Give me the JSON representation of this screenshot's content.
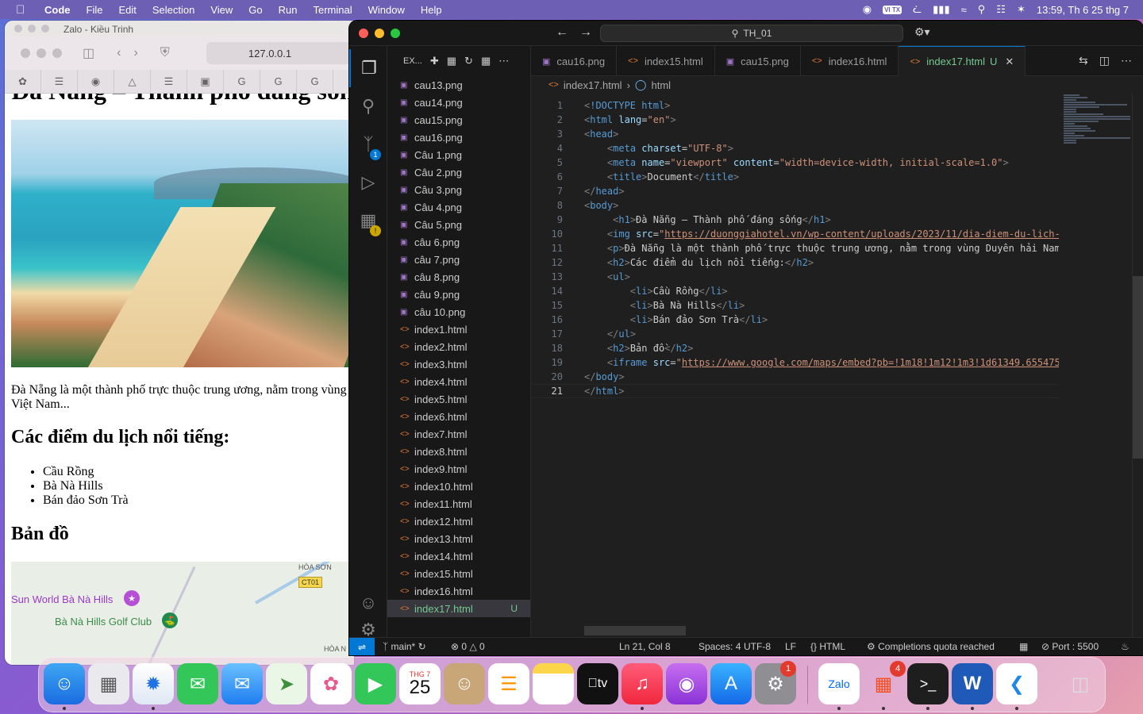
{
  "menubar": {
    "app_name": "Code",
    "menus": [
      "File",
      "Edit",
      "Selection",
      "View",
      "Go",
      "Run",
      "Terminal",
      "Window",
      "Help"
    ],
    "input_source": "VI TX",
    "clock": "13:59, Th 6 25 thg 7"
  },
  "browser": {
    "behind_window_title": "Zalo - Kiều Trinh",
    "url": "127.0.0.1",
    "page": {
      "heading_partial": "Đà Nẵng – Thành phố đáng sống",
      "paragraph_line1": "Đà Nẵng là một thành phố trực thuộc trung ương, nằm trong vùng",
      "paragraph_line2": "Việt Nam...",
      "h2_places": "Các điểm du lịch nổi tiếng:",
      "places": [
        "Cầu Rồng",
        "Bà Nà Hills",
        "Bán đảo Sơn Trà"
      ],
      "h2_map": "Bản đồ",
      "map_labels": {
        "sun_world": "Sun World Bà Nà Hills",
        "golf": "Bà Nà Hills Golf Club",
        "hoa_son": "HÒA SƠN",
        "hoa_n": "HÒA N",
        "road": "CT01"
      }
    }
  },
  "vscode": {
    "command_center": "TH_01",
    "explorer_title": "EX...",
    "files": [
      {
        "name": "cau13.png",
        "type": "img"
      },
      {
        "name": "cau14.png",
        "type": "img"
      },
      {
        "name": "cau15.png",
        "type": "img"
      },
      {
        "name": "cau16.png",
        "type": "img"
      },
      {
        "name": "Câu 1.png",
        "type": "img"
      },
      {
        "name": "Câu 2.png",
        "type": "img"
      },
      {
        "name": "Câu 3.png",
        "type": "img"
      },
      {
        "name": "Câu 4.png",
        "type": "img"
      },
      {
        "name": "Câu 5.png",
        "type": "img"
      },
      {
        "name": "câu 6.png",
        "type": "img"
      },
      {
        "name": "câu 7.png",
        "type": "img"
      },
      {
        "name": "câu 8.png",
        "type": "img"
      },
      {
        "name": "câu 9.png",
        "type": "img"
      },
      {
        "name": "câu 10.png",
        "type": "img"
      },
      {
        "name": "index1.html",
        "type": "html"
      },
      {
        "name": "index2.html",
        "type": "html"
      },
      {
        "name": "index3.html",
        "type": "html"
      },
      {
        "name": "index4.html",
        "type": "html"
      },
      {
        "name": "index5.html",
        "type": "html"
      },
      {
        "name": "index6.html",
        "type": "html"
      },
      {
        "name": "index7.html",
        "type": "html"
      },
      {
        "name": "index8.html",
        "type": "html"
      },
      {
        "name": "index9.html",
        "type": "html"
      },
      {
        "name": "index10.html",
        "type": "html"
      },
      {
        "name": "index11.html",
        "type": "html"
      },
      {
        "name": "index12.html",
        "type": "html"
      },
      {
        "name": "index13.html",
        "type": "html"
      },
      {
        "name": "index14.html",
        "type": "html"
      },
      {
        "name": "index15.html",
        "type": "html"
      },
      {
        "name": "index16.html",
        "type": "html"
      },
      {
        "name": "index17.html",
        "type": "html",
        "active": true,
        "status": "U"
      }
    ],
    "tabs": [
      {
        "label": "cau16.png",
        "type": "img"
      },
      {
        "label": "index15.html",
        "type": "html"
      },
      {
        "label": "cau15.png",
        "type": "img"
      },
      {
        "label": "index16.html",
        "type": "html"
      },
      {
        "label": "index17.html",
        "type": "html",
        "active": true,
        "status": "U"
      }
    ],
    "breadcrumb": [
      "index17.html",
      "html"
    ],
    "code_lines": [
      "<!DOCTYPE html>",
      "<html lang=\"en\">",
      "<head>",
      "    <meta charset=\"UTF-8\">",
      "    <meta name=\"viewport\" content=\"width=device-width, initial-scale=1.0\">",
      "    <title>Document</title>",
      "</head>",
      "<body>",
      "     <h1>Đà Nẵng – Thành phố đáng sống</h1>",
      "    <img src=\"https://duonggiahotel.vn/wp-content/uploads/2023/11/dia-diem-du-lich-",
      "    <p>Đà Nẵng là một thành phố trực thuộc trung ương, nằm trong vùng Duyên hải Nam",
      "    <h2>Các điểm du lịch nổi tiếng:</h2>",
      "    <ul>",
      "        <li>Cầu Rồng</li>",
      "        <li>Bà Nà Hills</li>",
      "        <li>Bán đảo Sơn Trà</li>",
      "    </ul>",
      "    <h2>Bản đồ</h2>",
      "    <iframe src=\"https://www.google.com/maps/embed?pb=!1m18!1m12!1m3!1d61349.655475",
      "</body>",
      "</html>"
    ],
    "current_line": 21,
    "status": {
      "branch": "main*",
      "errors": "0",
      "warnings": "0",
      "cursor": "Ln 21, Col 8",
      "spaces": "Spaces: 4",
      "encoding": "UTF-8",
      "eol": "LF",
      "language": "HTML",
      "copilot": "Completions quota reached",
      "port": "Port : 5500"
    }
  },
  "dock": {
    "calendar_month": "THG 7",
    "calendar_day": "25",
    "settings_badge": "1",
    "office_badge": "4",
    "zalo_label": "Zalo",
    "appletv_label": "tv"
  },
  "colors": {
    "accent": "#0078d4",
    "git_untracked": "#73c991",
    "html_icon": "#e37933",
    "image_icon": "#a074c4"
  }
}
